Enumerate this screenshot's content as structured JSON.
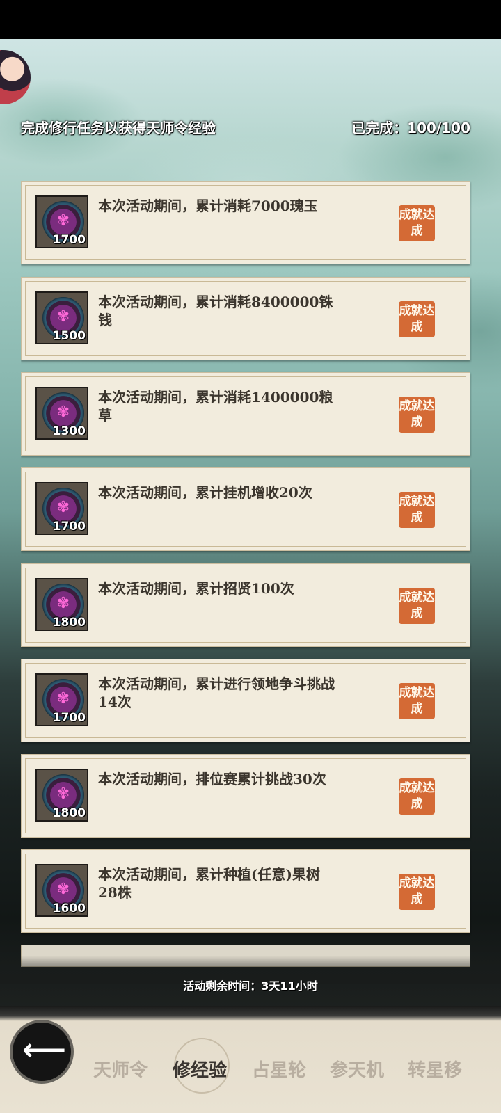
{
  "header": {
    "title": "完成修行任务以获得天师令经验",
    "progress": "已完成：100/100"
  },
  "tasks": [
    {
      "desc": "本次活动期间，累计消耗7000瑰玉",
      "amount": "1700",
      "status": "成就达成"
    },
    {
      "desc": "本次活动期间，累计消耗8400000铢钱",
      "amount": "1500",
      "status": "成就达成"
    },
    {
      "desc": "本次活动期间，累计消耗1400000粮草",
      "amount": "1300",
      "status": "成就达成"
    },
    {
      "desc": "本次活动期间，累计挂机增收20次",
      "amount": "1700",
      "status": "成就达成"
    },
    {
      "desc": "本次活动期间，累计招贤100次",
      "amount": "1800",
      "status": "成就达成"
    },
    {
      "desc": "本次活动期间，累计进行领地争斗挑战14次",
      "amount": "1700",
      "status": "成就达成"
    },
    {
      "desc": "本次活动期间，排位赛累计挑战30次",
      "amount": "1800",
      "status": "成就达成"
    },
    {
      "desc": "本次活动期间，累计种植(任意)果树28株",
      "amount": "1600",
      "status": "成就达成"
    }
  ],
  "footer": {
    "timer": "活动剩余时间：3天11小时"
  },
  "nav": {
    "back_icon": "back-arrow-icon",
    "items": [
      {
        "label": "天师令",
        "active": false
      },
      {
        "label": "修经验",
        "active": true
      },
      {
        "label": "占星轮",
        "active": false
      },
      {
        "label": "参天机",
        "active": false
      },
      {
        "label": "转星移",
        "active": false
      }
    ]
  },
  "colors": {
    "card_bg": "#f2ecdd",
    "stamp": "#d46a35",
    "nav_active": "#3a3530",
    "nav_inactive": "#b8aea0"
  }
}
